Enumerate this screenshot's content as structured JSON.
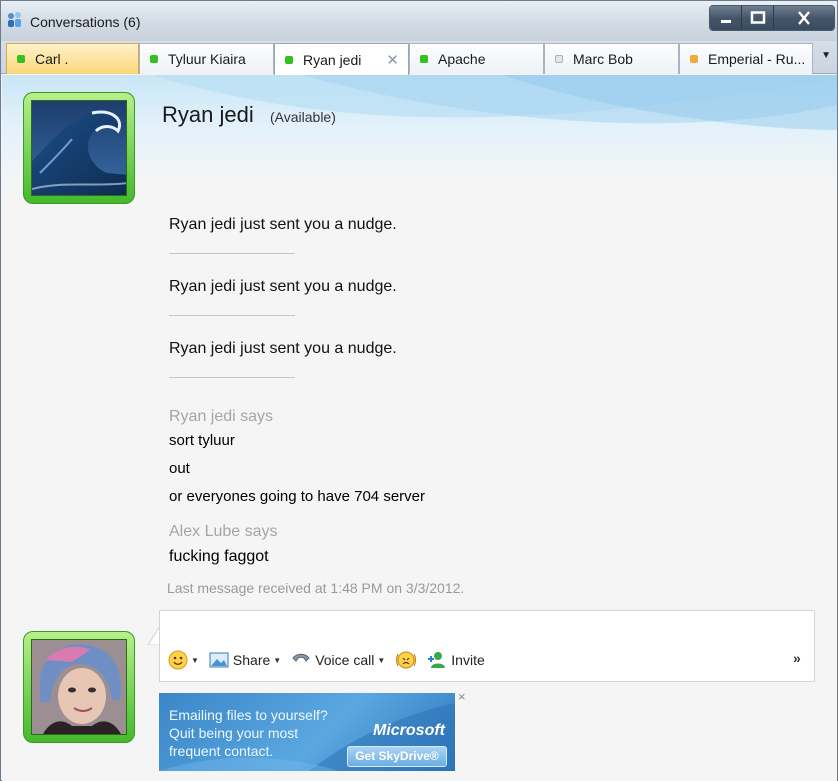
{
  "window": {
    "title": "Conversations (6)"
  },
  "tabs": [
    {
      "label": "Carl .",
      "status_color": "#34c11e",
      "state": "alert"
    },
    {
      "label": "Tyluur Kiaira",
      "status_color": "#34c11e",
      "state": "normal"
    },
    {
      "label": "Ryan jedi",
      "status_color": "#34c11e",
      "state": "current",
      "close_glyph": "✕"
    },
    {
      "label": "Apache",
      "status_color": "#34c11e",
      "state": "normal"
    },
    {
      "label": "Marc Bob",
      "status_color": "#e3e7ec",
      "state": "normal"
    },
    {
      "label": "Emperial - Ru...",
      "status_color": "#f2a93b",
      "state": "normal"
    }
  ],
  "tab_overflow_icon": "chevron-down-icon",
  "contact": {
    "name": "Ryan jedi",
    "status": "(Available)",
    "avatar": "wave-image"
  },
  "conversation": {
    "nudges": [
      "Ryan jedi just sent you a nudge.",
      "Ryan jedi just sent you a nudge.",
      "Ryan jedi just sent you a nudge."
    ],
    "blocks": [
      {
        "sender": "Ryan jedi says",
        "messages": [
          "sort tyluur",
          "out",
          "or everyones going to have 704 server"
        ]
      },
      {
        "sender": "Alex Lube says",
        "messages": [
          "fucking faggot"
        ]
      }
    ],
    "last_message": "Last message received at 1:48 PM on 3/3/2012."
  },
  "toolbar": {
    "emoticon_icon": "smiley-icon",
    "share_label": "Share",
    "voice_call_label": "Voice call",
    "invite_label": "Invite",
    "more_label": "»"
  },
  "self": {
    "avatar": "user-photo"
  },
  "ad": {
    "lines": [
      "Emailing files to yourself?",
      "Quit being your most",
      "frequent contact."
    ],
    "brand": "Microsoft",
    "cta": "Get SkyDrive®",
    "close": "×"
  }
}
